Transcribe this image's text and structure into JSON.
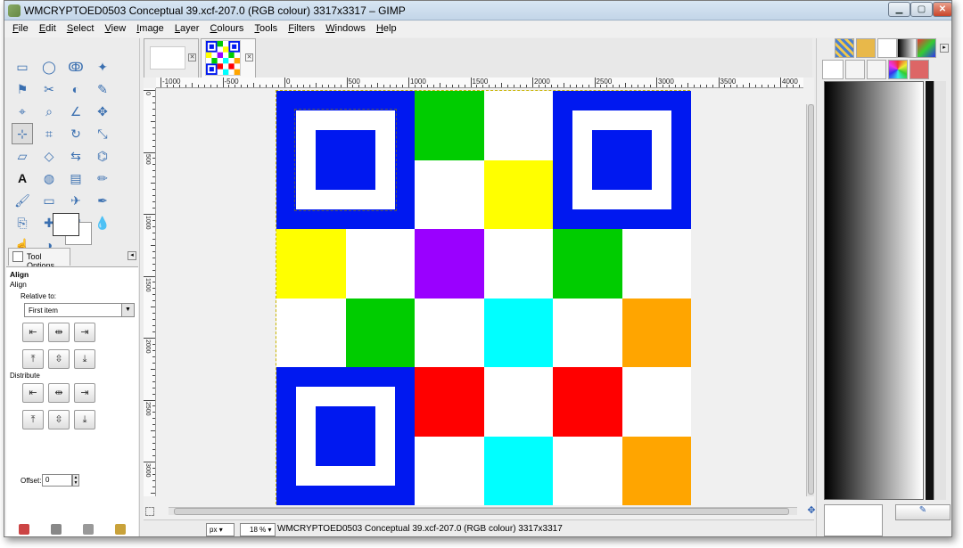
{
  "window": {
    "title": "WMCRYPTOED0503 Conceptual 39.xcf-207.0 (RGB colour) 3317x3317 – GIMP",
    "min_symbol": "▁",
    "max_symbol": "▢",
    "close_symbol": "✕"
  },
  "menu": [
    "File",
    "Edit",
    "Select",
    "View",
    "Image",
    "Layer",
    "Colours",
    "Tools",
    "Filters",
    "Windows",
    "Help"
  ],
  "toolbox": {
    "tools": [
      "rect-select",
      "ellipse-select",
      "free-select",
      "fuzzy-select",
      "color-select",
      "scissors-select",
      "foreground-select",
      "paths",
      "color-picker",
      "zoom",
      "measure",
      "move",
      "align",
      "crop",
      "rotate",
      "scale",
      "shear",
      "perspective",
      "flip",
      "cage",
      "text",
      "bucket-fill",
      "blend",
      "pencil",
      "paintbrush",
      "eraser",
      "airbrush",
      "ink",
      "clone",
      "heal",
      "perspective-clone",
      "blur",
      "smudge",
      "dodge-burn"
    ],
    "active_tool": "align"
  },
  "tool_options": {
    "tab_label": "Tool Options",
    "heading": "Align",
    "subheading": "Align",
    "relative_label": "Relative to:",
    "relative_value": "First item",
    "distribute_label": "Distribute",
    "offset_label": "Offset:",
    "offset_value": "0"
  },
  "image_tabs": [
    {
      "name": "blank-image"
    },
    {
      "name": "qr-image"
    }
  ],
  "ruler": {
    "h_labels": [
      "-1000",
      "-500",
      "0",
      "500",
      "1000",
      "1500",
      "2000",
      "2500",
      "3000",
      "3500",
      "4000"
    ],
    "v_labels": [
      "0",
      "500",
      "1000",
      "1500",
      "2000",
      "2500",
      "3000"
    ]
  },
  "image_content": {
    "grid_cols": 6,
    "grid_rows": 6,
    "colors": {
      "blue": "#0018f0",
      "green": "#00cc00",
      "yellow": "#ffff00",
      "purple": "#9a00ff",
      "cyan": "#00ffff",
      "orange": "#ffa500",
      "red": "#ff0000",
      "white": "#ffffff"
    },
    "cells": [
      {
        "row": 0,
        "col": 2,
        "color": "green"
      },
      {
        "row": 0,
        "col": 3,
        "color": "white"
      },
      {
        "row": 1,
        "col": 2,
        "color": "white"
      },
      {
        "row": 1,
        "col": 3,
        "color": "yellow"
      },
      {
        "row": 2,
        "col": 0,
        "color": "yellow"
      },
      {
        "row": 2,
        "col": 1,
        "color": "white"
      },
      {
        "row": 2,
        "col": 2,
        "color": "purple"
      },
      {
        "row": 2,
        "col": 3,
        "color": "white"
      },
      {
        "row": 2,
        "col": 4,
        "color": "green"
      },
      {
        "row": 2,
        "col": 5,
        "color": "white"
      },
      {
        "row": 3,
        "col": 0,
        "color": "white"
      },
      {
        "row": 3,
        "col": 1,
        "color": "green"
      },
      {
        "row": 3,
        "col": 2,
        "color": "white"
      },
      {
        "row": 3,
        "col": 3,
        "color": "cyan"
      },
      {
        "row": 3,
        "col": 4,
        "color": "white"
      },
      {
        "row": 3,
        "col": 5,
        "color": "orange"
      },
      {
        "row": 4,
        "col": 2,
        "color": "red"
      },
      {
        "row": 4,
        "col": 3,
        "color": "white"
      },
      {
        "row": 4,
        "col": 4,
        "color": "red"
      },
      {
        "row": 4,
        "col": 5,
        "color": "white"
      },
      {
        "row": 5,
        "col": 2,
        "color": "white"
      },
      {
        "row": 5,
        "col": 3,
        "color": "cyan"
      },
      {
        "row": 5,
        "col": 4,
        "color": "white"
      },
      {
        "row": 5,
        "col": 5,
        "color": "orange"
      }
    ],
    "finders": [
      {
        "row": 0,
        "col": 0,
        "selected": true
      },
      {
        "row": 0,
        "col": 4,
        "selected": false
      },
      {
        "row": 4,
        "col": 0,
        "selected": false
      }
    ]
  },
  "statusbar": {
    "unit": "px",
    "unit_arrow": "▾",
    "zoom": "18 %",
    "zoom_arrow": "▾",
    "message": "WMCRYPTOED0503 Conceptual 39.xcf-207.0 (RGB colour) 3317x3317"
  },
  "dock": {
    "tabs": [
      "patterns",
      "brushes",
      "fonts",
      "gradients",
      "palettes"
    ],
    "sub_tabs": [
      "layers",
      "channels",
      "paths",
      "colours",
      "undo"
    ]
  }
}
